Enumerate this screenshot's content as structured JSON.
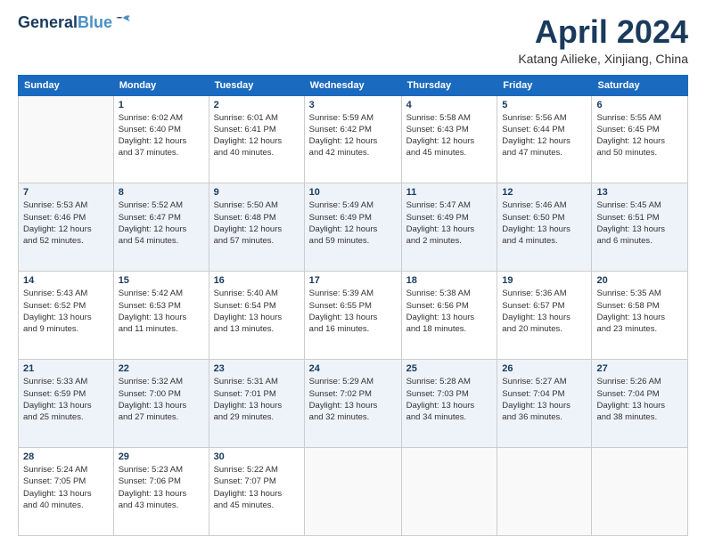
{
  "header": {
    "logo_line1": "General",
    "logo_line2": "Blue",
    "month": "April 2024",
    "location": "Katang Ailieke, Xinjiang, China"
  },
  "weekdays": [
    "Sunday",
    "Monday",
    "Tuesday",
    "Wednesday",
    "Thursday",
    "Friday",
    "Saturday"
  ],
  "weeks": [
    [
      {
        "day": "",
        "info": ""
      },
      {
        "day": "1",
        "info": "Sunrise: 6:02 AM\nSunset: 6:40 PM\nDaylight: 12 hours\nand 37 minutes."
      },
      {
        "day": "2",
        "info": "Sunrise: 6:01 AM\nSunset: 6:41 PM\nDaylight: 12 hours\nand 40 minutes."
      },
      {
        "day": "3",
        "info": "Sunrise: 5:59 AM\nSunset: 6:42 PM\nDaylight: 12 hours\nand 42 minutes."
      },
      {
        "day": "4",
        "info": "Sunrise: 5:58 AM\nSunset: 6:43 PM\nDaylight: 12 hours\nand 45 minutes."
      },
      {
        "day": "5",
        "info": "Sunrise: 5:56 AM\nSunset: 6:44 PM\nDaylight: 12 hours\nand 47 minutes."
      },
      {
        "day": "6",
        "info": "Sunrise: 5:55 AM\nSunset: 6:45 PM\nDaylight: 12 hours\nand 50 minutes."
      }
    ],
    [
      {
        "day": "7",
        "info": "Sunrise: 5:53 AM\nSunset: 6:46 PM\nDaylight: 12 hours\nand 52 minutes."
      },
      {
        "day": "8",
        "info": "Sunrise: 5:52 AM\nSunset: 6:47 PM\nDaylight: 12 hours\nand 54 minutes."
      },
      {
        "day": "9",
        "info": "Sunrise: 5:50 AM\nSunset: 6:48 PM\nDaylight: 12 hours\nand 57 minutes."
      },
      {
        "day": "10",
        "info": "Sunrise: 5:49 AM\nSunset: 6:49 PM\nDaylight: 12 hours\nand 59 minutes."
      },
      {
        "day": "11",
        "info": "Sunrise: 5:47 AM\nSunset: 6:49 PM\nDaylight: 13 hours\nand 2 minutes."
      },
      {
        "day": "12",
        "info": "Sunrise: 5:46 AM\nSunset: 6:50 PM\nDaylight: 13 hours\nand 4 minutes."
      },
      {
        "day": "13",
        "info": "Sunrise: 5:45 AM\nSunset: 6:51 PM\nDaylight: 13 hours\nand 6 minutes."
      }
    ],
    [
      {
        "day": "14",
        "info": "Sunrise: 5:43 AM\nSunset: 6:52 PM\nDaylight: 13 hours\nand 9 minutes."
      },
      {
        "day": "15",
        "info": "Sunrise: 5:42 AM\nSunset: 6:53 PM\nDaylight: 13 hours\nand 11 minutes."
      },
      {
        "day": "16",
        "info": "Sunrise: 5:40 AM\nSunset: 6:54 PM\nDaylight: 13 hours\nand 13 minutes."
      },
      {
        "day": "17",
        "info": "Sunrise: 5:39 AM\nSunset: 6:55 PM\nDaylight: 13 hours\nand 16 minutes."
      },
      {
        "day": "18",
        "info": "Sunrise: 5:38 AM\nSunset: 6:56 PM\nDaylight: 13 hours\nand 18 minutes."
      },
      {
        "day": "19",
        "info": "Sunrise: 5:36 AM\nSunset: 6:57 PM\nDaylight: 13 hours\nand 20 minutes."
      },
      {
        "day": "20",
        "info": "Sunrise: 5:35 AM\nSunset: 6:58 PM\nDaylight: 13 hours\nand 23 minutes."
      }
    ],
    [
      {
        "day": "21",
        "info": "Sunrise: 5:33 AM\nSunset: 6:59 PM\nDaylight: 13 hours\nand 25 minutes."
      },
      {
        "day": "22",
        "info": "Sunrise: 5:32 AM\nSunset: 7:00 PM\nDaylight: 13 hours\nand 27 minutes."
      },
      {
        "day": "23",
        "info": "Sunrise: 5:31 AM\nSunset: 7:01 PM\nDaylight: 13 hours\nand 29 minutes."
      },
      {
        "day": "24",
        "info": "Sunrise: 5:29 AM\nSunset: 7:02 PM\nDaylight: 13 hours\nand 32 minutes."
      },
      {
        "day": "25",
        "info": "Sunrise: 5:28 AM\nSunset: 7:03 PM\nDaylight: 13 hours\nand 34 minutes."
      },
      {
        "day": "26",
        "info": "Sunrise: 5:27 AM\nSunset: 7:04 PM\nDaylight: 13 hours\nand 36 minutes."
      },
      {
        "day": "27",
        "info": "Sunrise: 5:26 AM\nSunset: 7:04 PM\nDaylight: 13 hours\nand 38 minutes."
      }
    ],
    [
      {
        "day": "28",
        "info": "Sunrise: 5:24 AM\nSunset: 7:05 PM\nDaylight: 13 hours\nand 40 minutes."
      },
      {
        "day": "29",
        "info": "Sunrise: 5:23 AM\nSunset: 7:06 PM\nDaylight: 13 hours\nand 43 minutes."
      },
      {
        "day": "30",
        "info": "Sunrise: 5:22 AM\nSunset: 7:07 PM\nDaylight: 13 hours\nand 45 minutes."
      },
      {
        "day": "",
        "info": ""
      },
      {
        "day": "",
        "info": ""
      },
      {
        "day": "",
        "info": ""
      },
      {
        "day": "",
        "info": ""
      }
    ]
  ]
}
